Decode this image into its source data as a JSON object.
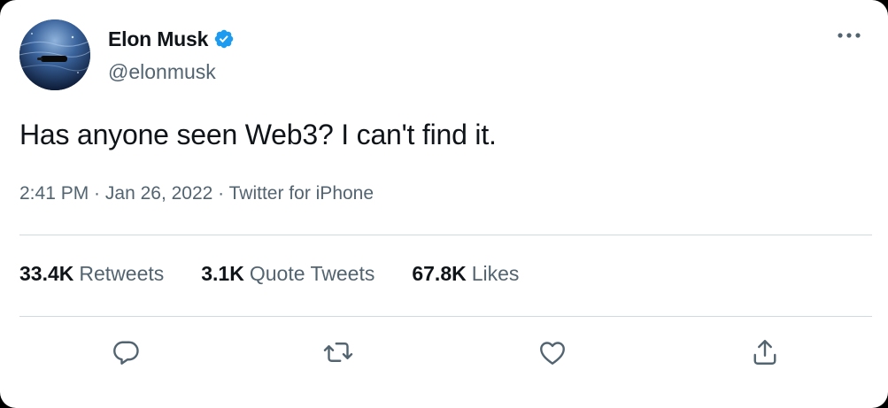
{
  "author": {
    "name": "Elon Musk",
    "handle": "@elonmusk",
    "verified": true,
    "verified_color": "#1d9bf0"
  },
  "tweet": {
    "text": "Has anyone seen Web3? I can't find it.",
    "time": "2:41 PM",
    "date": "Jan 26, 2022",
    "source": "Twitter for iPhone",
    "separator": " · "
  },
  "stats": {
    "retweets": {
      "count": "33.4K",
      "label": "Retweets"
    },
    "quote_tweets": {
      "count": "3.1K",
      "label": "Quote Tweets"
    },
    "likes": {
      "count": "67.8K",
      "label": "Likes"
    }
  },
  "actions": {
    "icons": [
      "reply-icon",
      "retweet-icon",
      "like-icon",
      "share-icon"
    ]
  },
  "colors": {
    "text_primary": "#0f1419",
    "text_secondary": "#536471",
    "divider": "#cfd9de",
    "background": "#ffffff"
  }
}
